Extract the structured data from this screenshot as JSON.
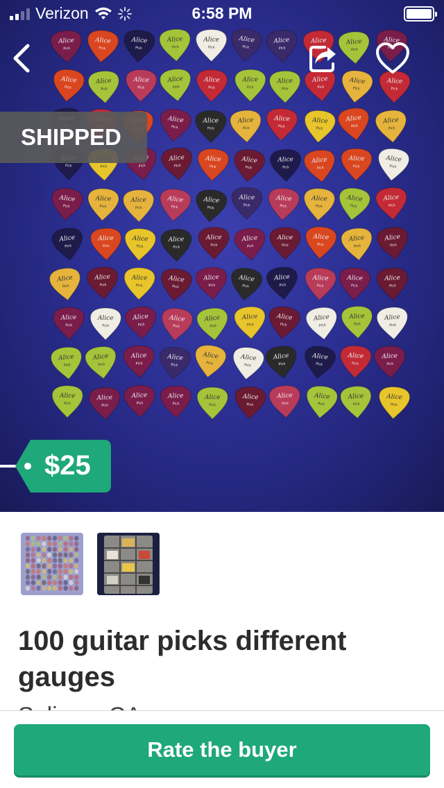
{
  "status_bar": {
    "carrier": "Verizon",
    "time": "6:58 PM",
    "signal_bars": 2,
    "battery_level": 1.0
  },
  "listing": {
    "badge": "SHIPPED",
    "price": "$25",
    "title": "100 guitar picks different gauges",
    "location": "Salinas, CA",
    "thumbnail_count": 2,
    "pick_brand": "Alice",
    "pick_label": "Pick"
  },
  "actions": {
    "rate_label": "Rate the buyer"
  },
  "icons": {
    "back": "chevron-left-icon",
    "share": "share-icon",
    "favorite": "heart-icon",
    "wifi": "wifi-icon",
    "loading": "activity-spinner-icon",
    "battery": "battery-icon"
  },
  "colors": {
    "brand_green": "#1fa879",
    "image_background": "#2c2f92",
    "shipped_badge": "#5a5a5a"
  }
}
